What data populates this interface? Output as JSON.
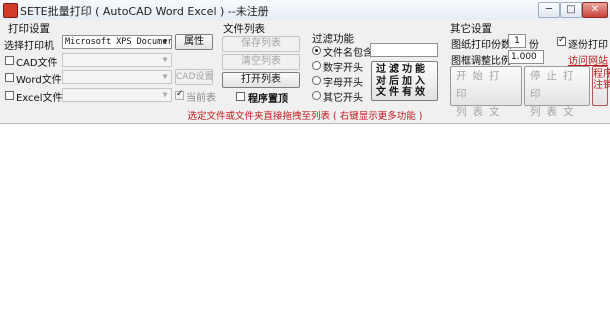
{
  "window": {
    "title": "SETE批量打印 ( AutoCAD Word Excel ) --未注册",
    "min_glyph": "─",
    "max_glyph": "□",
    "close_glyph": "✕"
  },
  "printer_group": {
    "title": "打印设置",
    "printer_label": "选择打印机",
    "printer_value": "Microsoft XPS Documer",
    "properties_button": "属性",
    "cad_label": "CAD文件",
    "cad_checked": false,
    "cad_settings_button": "CAD设置",
    "word_label": "Word文件",
    "word_checked": false,
    "excel_label": "Excel文件",
    "excel_checked": false,
    "current_table_label": "当前表",
    "current_table_checked": true
  },
  "file_list_group": {
    "title": "文件列表",
    "save_list": "保存列表",
    "clear_list": "清空列表",
    "open_list": "打开列表",
    "pin_label": "程序置顶",
    "pin_checked": false
  },
  "filter_group": {
    "title": "过滤功能",
    "options": [
      {
        "label": "文件名包含",
        "selected": true
      },
      {
        "label": "数字开头",
        "selected": false
      },
      {
        "label": "字母开头",
        "selected": false
      },
      {
        "label": "其它开头",
        "selected": false
      }
    ],
    "filter_text": "",
    "filter_button_lines": [
      "过滤功能",
      "对后加入",
      "文件有效"
    ]
  },
  "other_group": {
    "title": "其它设置",
    "copies_label": "图纸打印份数",
    "copies_value": "1",
    "copies_unit": "份",
    "reverse_label": "逐份打印",
    "reverse_checked": true,
    "scale_label": "图框调整比例",
    "scale_value": "1.000",
    "website_link": "访问网站",
    "start_print_lines": [
      "开始打印",
      "列表文件"
    ],
    "stop_print_lines": [
      "停止打印",
      "列表文件"
    ],
    "quit_lines": [
      "程序",
      "注销"
    ]
  },
  "hint": "选定文件或文件夹直接拖拽至列表 ( 右键显示更多功能 )"
}
